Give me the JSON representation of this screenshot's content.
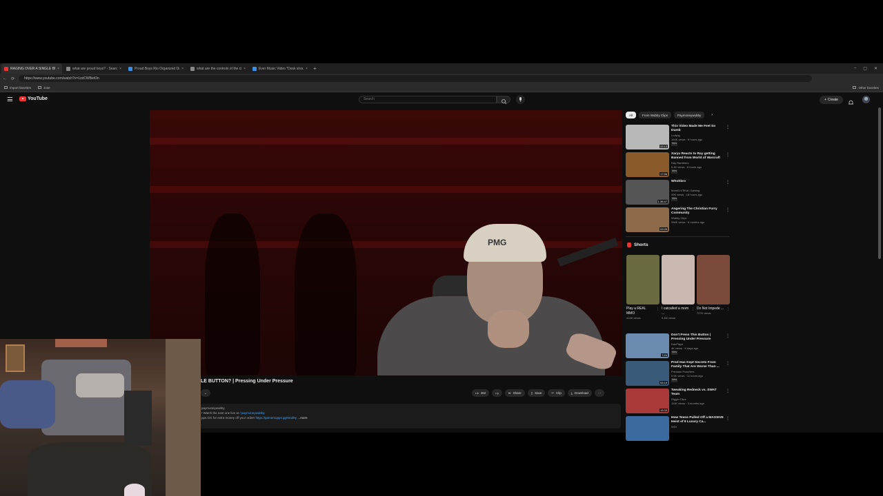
{
  "browser": {
    "tabs": [
      {
        "title": "RAGING OVER A SINGLE BUTTON? | Pressing Under Pressure",
        "color": "#e33",
        "active": true
      },
      {
        "title": "what are proud boys? - Search",
        "color": "#888",
        "active": false
      },
      {
        "title": "Proud Boys Rio Organized Drug Cartel",
        "color": "#3a8ee6",
        "active": false
      },
      {
        "title": "what are the controls of the circu",
        "color": "#888",
        "active": false
      },
      {
        "title": "Ever Music Video *Desk should fun",
        "color": "#3a8ee6",
        "active": false
      }
    ],
    "url": "https://www.youtube.com/watch?v=1zdCWBetOn",
    "bookmarks": [
      "Import favorites",
      "Jose"
    ],
    "other_bookmarks": "Other favorites"
  },
  "youtube": {
    "logo": "YouTube",
    "search_placeholder": "Search",
    "create_label": "Create"
  },
  "video": {
    "title": "LE BUTTON? | Pressing Under Pressure",
    "cap_text": "PMG",
    "actions": {
      "like_count": "462",
      "share": "Share",
      "save": "Save",
      "clip": "Clip",
      "download": "Download"
    },
    "description": {
      "line1": "paymoneywubby",
      "line2_prefix": "! Watch the next one live at",
      "line2_link": "/ paymoneywubby",
      "line3_prefix": "pps.GG for extra money off your order!",
      "line3_link": "https://gamersupps.gg/Wubby",
      "more": "...more"
    }
  },
  "sidebar": {
    "chips": [
      "All",
      "From Wubby Clips",
      "Paymoneywubby"
    ],
    "recs_top": [
      {
        "title": "This Video Made Me Feel So Dumb",
        "channel": "Ludwig",
        "meta": "164K views · 8 hours ago",
        "badge": "New",
        "duration": "22:13",
        "thumb": "#b8b8b8"
      },
      {
        "title": "Xaryu Reacts to Ray getting Banned from World of Warcraft",
        "channel": "Ray Ramblers",
        "meta": "5.4K views · 6 hours ago",
        "badge": "New",
        "duration": "17:56",
        "thumb": "#8a5a2a"
      },
      {
        "title": "Whohbro",
        "channel": "MoistCr1TiKaL Gaming",
        "meta": "49K views · 16 hours ago",
        "badge": "New",
        "duration": "1:36:47",
        "thumb": "#555"
      },
      {
        "title": "Angering The Christian Furry Community",
        "channel": "Wubby Clips",
        "meta": "266K views · 6 months ago",
        "badge": "",
        "duration": "22:09",
        "thumb": "#8c6a4a"
      }
    ],
    "shorts_heading": "Shorts",
    "shorts": [
      {
        "title": "Play a REAL MMO",
        "views": "414K views",
        "thumb": "#6a6a40"
      },
      {
        "title": "I catcalled a mom ...",
        "views": "9.4M views",
        "thumb": "#c8b8b0"
      },
      {
        "title": "Do Not Impede ...",
        "views": "727K views",
        "thumb": "#7a4a3a"
      }
    ],
    "recs_bottom": [
      {
        "title": "Don't Press This Button | Pressing Under Pressure",
        "channel": "DanPlays",
        "meta": "4K views · 6 days ago",
        "badge": "New",
        "duration": "7:24",
        "thumb": "#6a8ab0"
      },
      {
        "title": "Pred Has Kept Secrets From Family That Are Worse Than ...",
        "channel": "Predator Poachers",
        "meta": "5.5K views · 11 hours ago",
        "badge": "New",
        "duration": "53:19",
        "thumb": "#3a5a7a"
      },
      {
        "title": "Tweaking Redneck vs. SWAT Team",
        "channel": "Gigglo Clips",
        "meta": "114K views · 3 months ago",
        "badge": "",
        "duration": "13:33",
        "thumb": "#aa3a3a"
      },
      {
        "title": "How Teens Pulled Off a MASSIVE Heist of 9 Luxury Ca...",
        "channel": "WDI",
        "meta": "",
        "badge": "",
        "duration": "",
        "thumb": "#3a6aa0"
      }
    ]
  }
}
